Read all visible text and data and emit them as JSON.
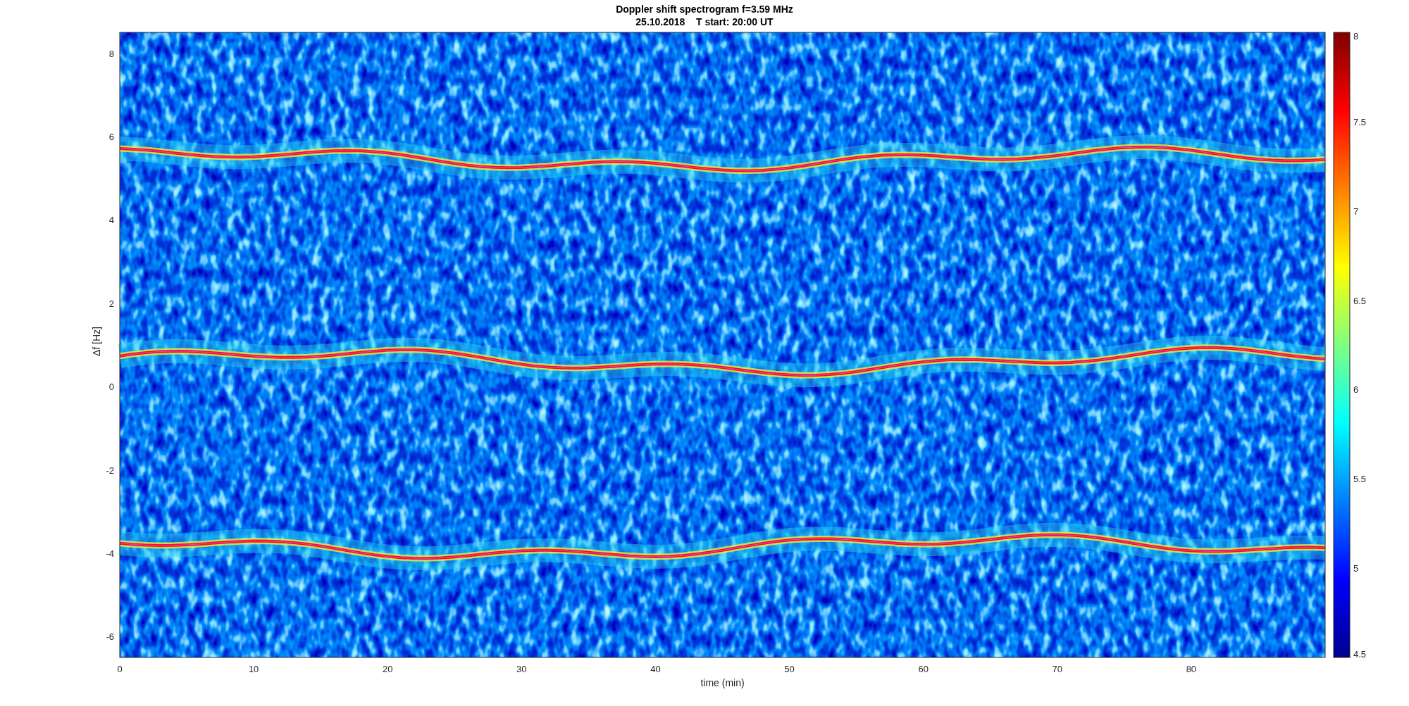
{
  "figure": {
    "title": [
      "Doppler shift spectrogram f=3.59 MHz",
      "25.10.2018    T start: 20:00 UT"
    ],
    "xlabel": "time (min)",
    "ylabel": "Δf [Hz]",
    "xticks": [
      "0",
      "10",
      "20",
      "30",
      "40",
      "50",
      "60",
      "70",
      "80"
    ],
    "yticks": [
      "8",
      "6",
      "4",
      "2",
      "0",
      "-2",
      "-4",
      "-6"
    ],
    "colorbar_ticks": [
      "8",
      "7.5",
      "7",
      "6.5",
      "6",
      "5.5",
      "5",
      "4.5"
    ]
  }
}
